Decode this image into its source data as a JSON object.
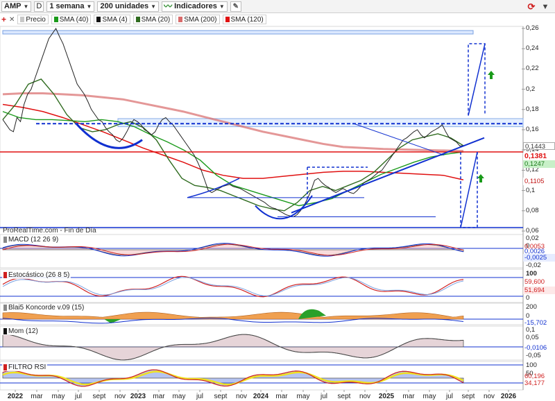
{
  "toolbar": {
    "symbol": "AMP",
    "d_button": "D",
    "period": "1 semana",
    "units": "200 unidades",
    "indicators": "Indicadores"
  },
  "legend": [
    {
      "label": "Precio",
      "color": "#d0d0d0"
    },
    {
      "label": "SMA (40)",
      "color": "#1a9a1a"
    },
    {
      "label": "SMA (4)",
      "color": "#111111"
    },
    {
      "label": "SMA (20)",
      "color": "#2f6b1f"
    },
    {
      "label": "SMA (200)",
      "color": "#d96b6b"
    },
    {
      "label": "SMA (120)",
      "color": "#e01010"
    }
  ],
  "caption": "ProRealTime.com - Fin de Día",
  "panels": {
    "macd": {
      "title": "MACD (12 26 9)",
      "ticks": [
        "0,02",
        "0",
        "-0,02"
      ],
      "values": [
        "0,0053",
        "0,0026",
        "-0,0025"
      ]
    },
    "stoch": {
      "title": "Estocástico (26 8 5)",
      "ticks": [
        "100",
        "0"
      ],
      "values": [
        "59,600",
        "51,694"
      ]
    },
    "konc": {
      "title": "Blai5 Koncorde v.09 (15)",
      "ticks": [
        "200",
        "0"
      ],
      "values": [
        "-15,702"
      ]
    },
    "mom": {
      "title": "Mom (12)",
      "ticks": [
        "0,1",
        "0,05",
        "-0,05"
      ],
      "values": [
        "-0,0106"
      ]
    },
    "rsi": {
      "title": "FILTRO RSI",
      "ticks": [
        "100",
        "50"
      ],
      "values": [
        "60,196",
        "34,177"
      ]
    }
  },
  "price_values": [
    "0,1443",
    "0,1381",
    "0,1247",
    "0,1105"
  ],
  "colors": {
    "price_red": "#e01010",
    "blue": "#1030d0",
    "accent": "#5aa0ff"
  },
  "chart_data": {
    "type": "line",
    "series_price": "Precio",
    "price_axis": {
      "ylim": [
        0.06,
        0.26
      ],
      "ticks": [
        "0,26",
        "0,24",
        "0,22",
        "0,2",
        "0,18",
        "0,16",
        "0,14",
        "0,12",
        "0,1",
        "0,08",
        "0,06"
      ]
    },
    "x_ticks": [
      "2022",
      "mar",
      "may",
      "jul",
      "sept",
      "nov",
      "2023",
      "mar",
      "may",
      "jul",
      "sept",
      "nov",
      "2024",
      "mar",
      "may",
      "jul",
      "sept",
      "nov",
      "2025",
      "mar",
      "may",
      "jul",
      "sept",
      "nov",
      "2026"
    ],
    "x_year_ticks": [
      "2022",
      "2023",
      "2024",
      "2025",
      "2026"
    ],
    "price_series_weekly_close": [
      0.17,
      0.165,
      0.16,
      0.158,
      0.172,
      0.168,
      0.185,
      0.195,
      0.2,
      0.21,
      0.22,
      0.23,
      0.24,
      0.25,
      0.255,
      0.26,
      0.252,
      0.245,
      0.235,
      0.225,
      0.215,
      0.205,
      0.2,
      0.195,
      0.188,
      0.18,
      0.175,
      0.17,
      0.168,
      0.162,
      0.158,
      0.155,
      0.15,
      0.148,
      0.152,
      0.158,
      0.165,
      0.17,
      0.168,
      0.165,
      0.16,
      0.158,
      0.155,
      0.158,
      0.165,
      0.17,
      0.172,
      0.168,
      0.165,
      0.16,
      0.155,
      0.15,
      0.145,
      0.14,
      0.135,
      0.128,
      0.12,
      0.11,
      0.1,
      0.098,
      0.1,
      0.102,
      0.104,
      0.105,
      0.106,
      0.104,
      0.103,
      0.102,
      0.1,
      0.098,
      0.096,
      0.094,
      0.092,
      0.09,
      0.088,
      0.085,
      0.083,
      0.082,
      0.08,
      0.078,
      0.076,
      0.075,
      0.074,
      0.076,
      0.08,
      0.085,
      0.092,
      0.1,
      0.11,
      0.112,
      0.108,
      0.105,
      0.103,
      0.1,
      0.098,
      0.1,
      0.102,
      0.1,
      0.098,
      0.097,
      0.1,
      0.104,
      0.108,
      0.11,
      0.112,
      0.115,
      0.118,
      0.12,
      0.125,
      0.13,
      0.135,
      0.14,
      0.145,
      0.15,
      0.152,
      0.155,
      0.158,
      0.16,
      0.155,
      0.152,
      0.155,
      0.158,
      0.16,
      0.162,
      0.165,
      0.158,
      0.152,
      0.15,
      0.148,
      0.144,
      0.1443
    ],
    "sma": [
      {
        "name": "SMA (120)",
        "color": "#e01010",
        "values": [
          0.185,
          0.182,
          0.178,
          0.172,
          0.165,
          0.158,
          0.15,
          0.142,
          0.135,
          0.128,
          0.12,
          0.115,
          0.112,
          0.112,
          0.114,
          0.116,
          0.118,
          0.119,
          0.119,
          0.118,
          0.117,
          0.116,
          0.115,
          0.1105
        ]
      },
      {
        "name": "SMA (200)",
        "color": "#d96b6b",
        "values": [
          0.195,
          0.196,
          0.196,
          0.195,
          0.194,
          0.192,
          0.19,
          0.186,
          0.182,
          0.178,
          0.173,
          0.168,
          0.163,
          0.158,
          0.154,
          0.15,
          0.146,
          0.143,
          0.142,
          0.141,
          0.1405,
          0.14,
          0.1395,
          0.139
        ]
      },
      {
        "name": "SMA (40)",
        "color": "#1a9a1a",
        "values": [
          0.178,
          0.172,
          0.17,
          0.17,
          0.169,
          0.168,
          0.17,
          0.168,
          0.163,
          0.155,
          0.148,
          0.14,
          0.13,
          0.115,
          0.105,
          0.1,
          0.095,
          0.09,
          0.085,
          0.088,
          0.092,
          0.1,
          0.108,
          0.116,
          0.122,
          0.128,
          0.133,
          0.136,
          0.1381
        ]
      },
      {
        "name": "SMA (20)",
        "color": "#2f6b1f",
        "values": [
          0.17,
          0.185,
          0.205,
          0.21,
          0.195,
          0.175,
          0.162,
          0.158,
          0.16,
          0.165,
          0.168,
          0.162,
          0.15,
          0.13,
          0.112,
          0.105,
          0.103,
          0.1,
          0.095,
          0.09,
          0.085,
          0.082,
          0.08,
          0.088,
          0.1,
          0.104,
          0.1,
          0.105,
          0.11,
          0.118,
          0.13,
          0.142,
          0.15,
          0.153,
          0.156,
          0.152,
          0.1443
        ]
      }
    ]
  }
}
